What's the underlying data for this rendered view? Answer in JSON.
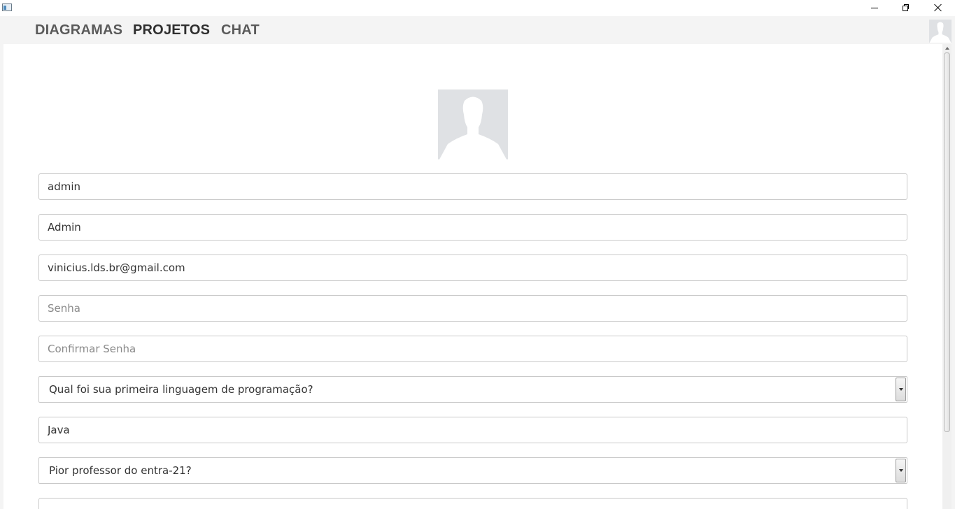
{
  "window": {
    "controls": {
      "minimize": "minimize",
      "maximize": "restore",
      "close": "close"
    }
  },
  "nav": {
    "items": [
      {
        "label": "DIAGRAMAS"
      },
      {
        "label": "PROJETOS"
      },
      {
        "label": "CHAT"
      }
    ],
    "active": "PROJETOS",
    "user_icon": "user-silhouette-icon"
  },
  "profile": {
    "photo_icon": "user-silhouette-icon",
    "fields": {
      "username": {
        "value": "admin",
        "placeholder": ""
      },
      "name": {
        "value": "Admin",
        "placeholder": ""
      },
      "email": {
        "value": "vinicius.lds.br@gmail.com",
        "placeholder": ""
      },
      "password": {
        "value": "",
        "placeholder": "Senha"
      },
      "confirm_password": {
        "value": "",
        "placeholder": "Confirmar Senha"
      },
      "security_question_1": {
        "selected": "Qual foi sua primeira linguagem de programação?"
      },
      "security_answer_1": {
        "value": "Java",
        "placeholder": ""
      },
      "security_question_2": {
        "selected": "Pior professor do entra-21?"
      }
    }
  },
  "colors": {
    "content_bg": "#ffffff",
    "nav_bg": "#f4f4f4",
    "nav_text": "#5a5a5a",
    "nav_active_text": "#2f2f2f",
    "field_border": "#c9c9c9",
    "avatar_bg": "#dfe1e4"
  }
}
